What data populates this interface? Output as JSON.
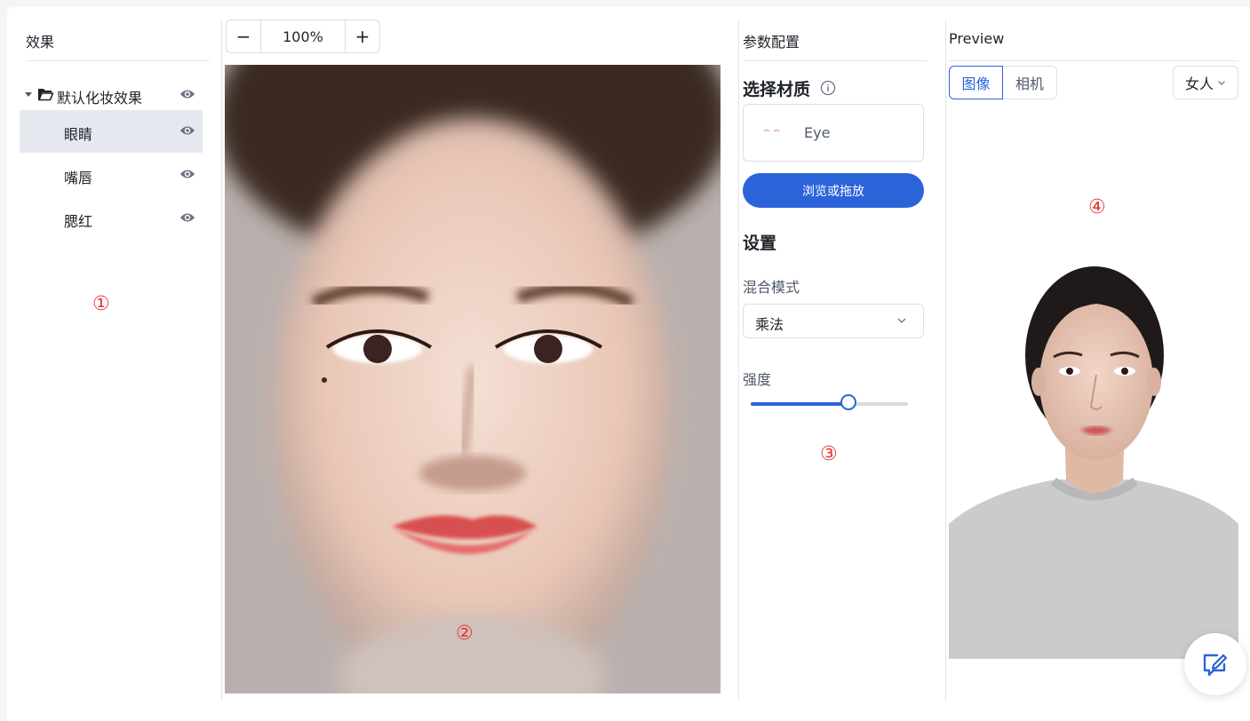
{
  "effects": {
    "title": "效果",
    "group": "默认化妆效果",
    "items": [
      {
        "label": "眼睛",
        "selected": true
      },
      {
        "label": "嘴唇",
        "selected": false
      },
      {
        "label": "腮红",
        "selected": false
      }
    ]
  },
  "canvas": {
    "zoom_minus": "−",
    "zoom_value": "100%",
    "zoom_plus": "+"
  },
  "params": {
    "title": "参数配置",
    "select_material": "选择材质",
    "material_name": "Eye",
    "browse_button": "浏览或拖放",
    "settings": "设置",
    "blend_mode_label": "混合模式",
    "blend_mode_value": "乘法",
    "strength_label": "强度",
    "strength_fraction": 0.62
  },
  "preview": {
    "title": "Preview",
    "tab_image": "图像",
    "tab_camera": "相机",
    "model_select": "女人"
  },
  "annotations": [
    "①",
    "②",
    "③",
    "④"
  ],
  "colors": {
    "accent": "#2b63d9",
    "annotation": "#e53935",
    "selected_row": "#e5e8ef"
  }
}
